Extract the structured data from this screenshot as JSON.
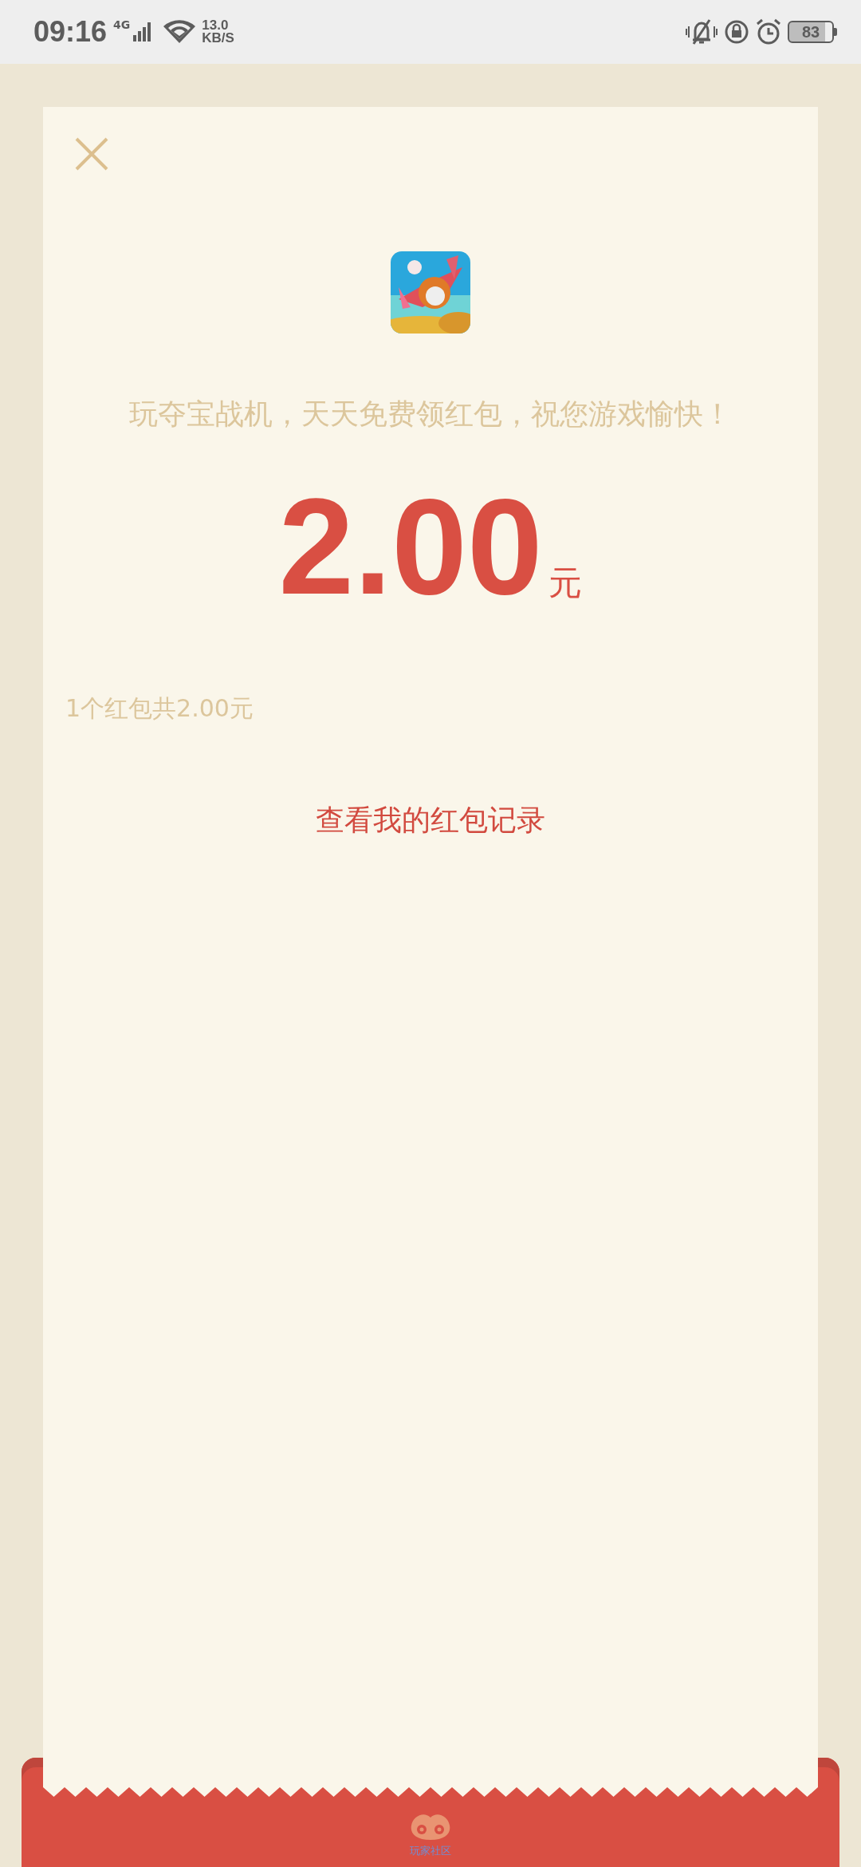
{
  "status_bar": {
    "time": "09:16",
    "network": "4G",
    "speed_value": "13.0",
    "speed_unit": "KB/S",
    "battery": "83"
  },
  "packet": {
    "message": "玩夺宝战机，天天免费领红包，祝您游戏愉快！",
    "amount": "2.00",
    "currency": "元",
    "summary": "1个红包共2.00元",
    "records_link": "查看我的红包记录"
  },
  "footer": {
    "label": "玩家社区"
  }
}
